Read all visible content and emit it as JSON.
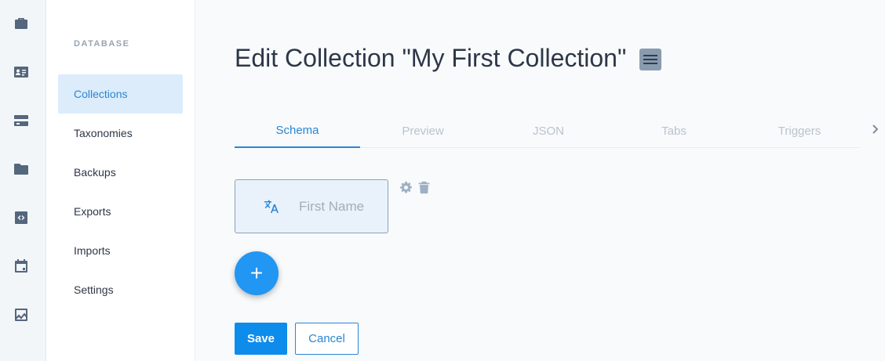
{
  "rail": {
    "icons": [
      "briefcase-icon",
      "contact-card-icon",
      "database-icon",
      "folder-icon",
      "code-file-icon",
      "calendar-icon",
      "activity-chart-icon"
    ]
  },
  "sidebar": {
    "heading": "DATABASE",
    "items": [
      {
        "label": "Collections",
        "active": true
      },
      {
        "label": "Taxonomies",
        "active": false
      },
      {
        "label": "Backups",
        "active": false
      },
      {
        "label": "Exports",
        "active": false
      },
      {
        "label": "Imports",
        "active": false
      },
      {
        "label": "Settings",
        "active": false
      }
    ]
  },
  "header": {
    "title": "Edit Collection \"My First Collection\"",
    "menu_icon": "hamburger-menu-icon"
  },
  "tabs": [
    {
      "label": "Schema",
      "active": true
    },
    {
      "label": "Preview",
      "active": false
    },
    {
      "label": "JSON",
      "active": false
    },
    {
      "label": "Tabs",
      "active": false
    },
    {
      "label": "Triggers",
      "active": false
    }
  ],
  "schema": {
    "fields": [
      {
        "label": "First Name",
        "icon": "translate-icon"
      }
    ],
    "add_button": "+"
  },
  "actions": {
    "save_label": "Save",
    "cancel_label": "Cancel"
  },
  "colors": {
    "accent": "#2b86d4",
    "primary_button": "#0d8cec",
    "fab": "#2196f3"
  }
}
